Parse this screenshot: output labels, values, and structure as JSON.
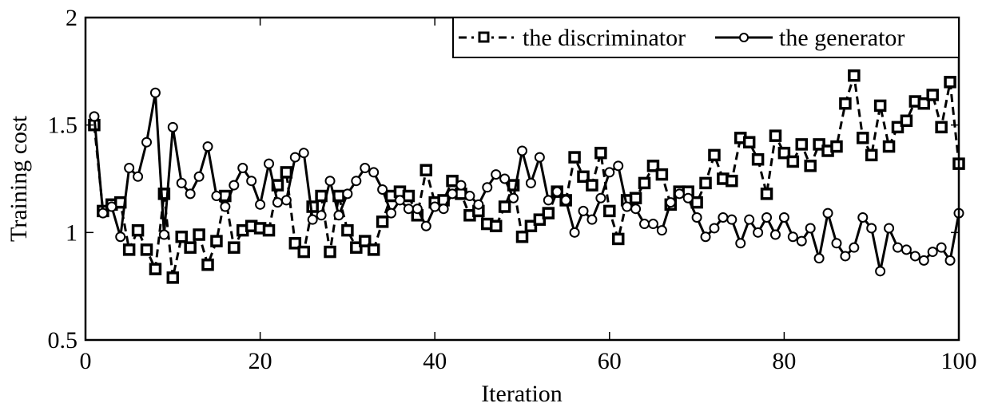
{
  "chart_data": {
    "type": "line",
    "title": "",
    "xlabel": "Iteration",
    "ylabel": "Training cost",
    "xlim": [
      0,
      100
    ],
    "ylim": [
      0.5,
      2
    ],
    "xticks": [
      0,
      20,
      40,
      60,
      80,
      100
    ],
    "xtick_labels": [
      "0",
      "20",
      "40",
      "60",
      "80",
      "100"
    ],
    "yticks": [
      0.5,
      1,
      1.5,
      2
    ],
    "ytick_labels": [
      "0.5",
      "1",
      "1.5",
      "2"
    ],
    "grid": false,
    "legend_position": "top-right",
    "x": [
      1,
      2,
      3,
      4,
      5,
      6,
      7,
      8,
      9,
      10,
      11,
      12,
      13,
      14,
      15,
      16,
      17,
      18,
      19,
      20,
      21,
      22,
      23,
      24,
      25,
      26,
      27,
      28,
      29,
      30,
      31,
      32,
      33,
      34,
      35,
      36,
      37,
      38,
      39,
      40,
      41,
      42,
      43,
      44,
      45,
      46,
      47,
      48,
      49,
      50,
      51,
      52,
      53,
      54,
      55,
      56,
      57,
      58,
      59,
      60,
      61,
      62,
      63,
      64,
      65,
      66,
      67,
      68,
      69,
      70,
      71,
      72,
      73,
      74,
      75,
      76,
      77,
      78,
      79,
      80,
      81,
      82,
      83,
      84,
      85,
      86,
      87,
      88,
      89,
      90,
      91,
      92,
      93,
      94,
      95,
      96,
      97,
      98,
      99,
      100
    ],
    "series": [
      {
        "name": "the discriminator",
        "line_style": "dashed",
        "marker": "square",
        "color": "#000000",
        "values": [
          1.5,
          1.1,
          1.13,
          1.14,
          0.92,
          1.01,
          0.92,
          0.83,
          1.18,
          0.79,
          0.98,
          0.93,
          0.99,
          0.85,
          0.96,
          1.17,
          0.93,
          1.01,
          1.03,
          1.02,
          1.01,
          1.22,
          1.28,
          0.95,
          0.91,
          1.12,
          1.17,
          0.91,
          1.17,
          1.01,
          0.93,
          0.96,
          0.92,
          1.05,
          1.17,
          1.19,
          1.17,
          1.08,
          1.29,
          1.14,
          1.15,
          1.24,
          1.18,
          1.08,
          1.1,
          1.04,
          1.03,
          1.12,
          1.22,
          0.98,
          1.03,
          1.06,
          1.09,
          1.19,
          1.15,
          1.35,
          1.26,
          1.22,
          1.37,
          1.1,
          0.97,
          1.15,
          1.16,
          1.23,
          1.31,
          1.27,
          1.13,
          1.19,
          1.19,
          1.14,
          1.23,
          1.36,
          1.25,
          1.24,
          1.44,
          1.42,
          1.34,
          1.18,
          1.45,
          1.37,
          1.33,
          1.41,
          1.31,
          1.41,
          1.38,
          1.4,
          1.6,
          1.73,
          1.44,
          1.36,
          1.59,
          1.4,
          1.49,
          1.52,
          1.61,
          1.6,
          1.64,
          1.49,
          1.7,
          1.32
        ]
      },
      {
        "name": "the generator",
        "line_style": "solid",
        "marker": "circle",
        "color": "#000000",
        "values": [
          1.54,
          1.09,
          1.12,
          0.98,
          1.3,
          1.26,
          1.42,
          1.65,
          0.99,
          1.49,
          1.23,
          1.18,
          1.26,
          1.4,
          1.17,
          1.12,
          1.22,
          1.3,
          1.24,
          1.13,
          1.32,
          1.14,
          1.15,
          1.35,
          1.37,
          1.06,
          1.08,
          1.24,
          1.08,
          1.18,
          1.24,
          1.3,
          1.28,
          1.2,
          1.09,
          1.15,
          1.11,
          1.11,
          1.03,
          1.12,
          1.11,
          1.18,
          1.22,
          1.17,
          1.13,
          1.21,
          1.27,
          1.25,
          1.16,
          1.38,
          1.23,
          1.35,
          1.15,
          1.19,
          1.15,
          1.0,
          1.1,
          1.06,
          1.16,
          1.28,
          1.31,
          1.12,
          1.11,
          1.04,
          1.04,
          1.01,
          1.14,
          1.18,
          1.16,
          1.07,
          0.98,
          1.02,
          1.07,
          1.06,
          0.95,
          1.06,
          1.0,
          1.07,
          0.99,
          1.07,
          0.98,
          0.96,
          1.02,
          0.88,
          1.09,
          0.95,
          0.89,
          0.93,
          1.07,
          1.02,
          0.82,
          1.02,
          0.93,
          0.92,
          0.89,
          0.87,
          0.91,
          0.93,
          0.87,
          1.09
        ]
      }
    ]
  }
}
